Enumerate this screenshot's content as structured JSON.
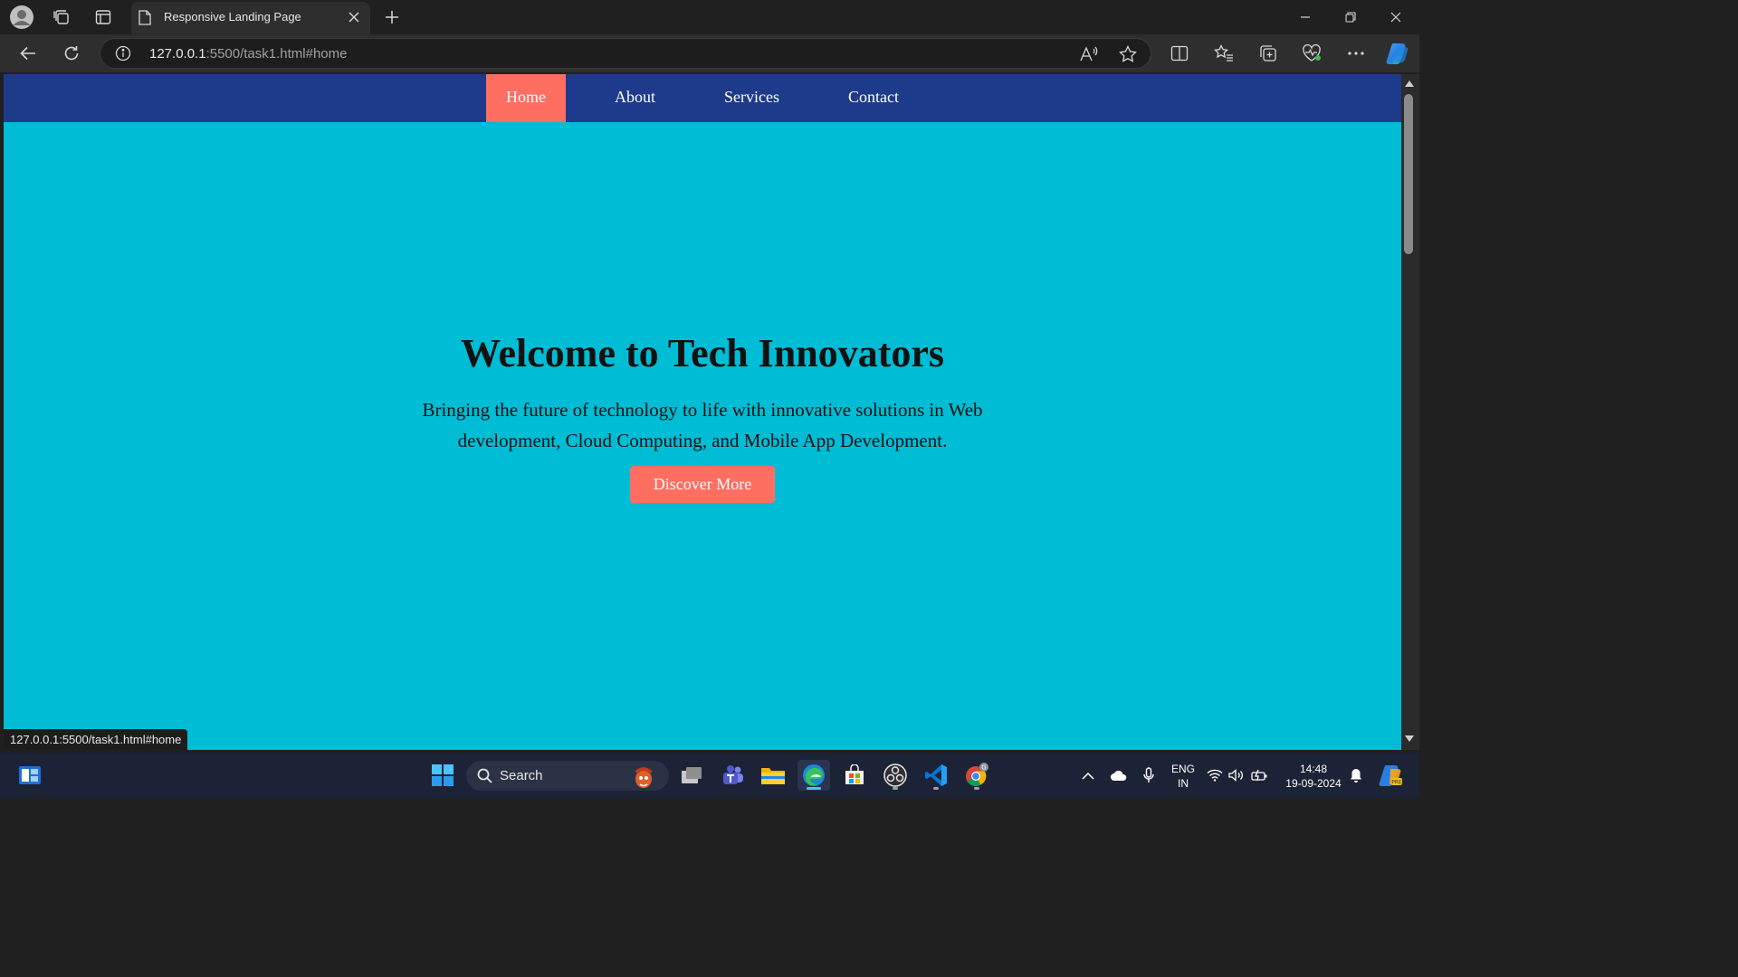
{
  "browser": {
    "tab": {
      "title": "Responsive Landing Page"
    },
    "address": {
      "host": "127.0.0.1",
      "rest": ":5500/task1.html#home"
    },
    "status_url": "127.0.0.1:5500/task1.html#home"
  },
  "page": {
    "nav": [
      {
        "label": "Home",
        "active": true
      },
      {
        "label": "About"
      },
      {
        "label": "Services"
      },
      {
        "label": "Contact"
      }
    ],
    "hero": {
      "title": "Welcome to Tech Innovators",
      "text": "Bringing the future of technology to life with innovative solutions in Web development, Cloud Computing, and Mobile App Development.",
      "button": "Discover More"
    },
    "colors": {
      "navbar": "#1e3a8a",
      "accent": "#ff6f61",
      "background": "#00bcd4"
    }
  },
  "taskbar": {
    "search_placeholder": "Search",
    "lang_1": "ENG",
    "lang_2": "IN",
    "time": "14:48",
    "date": "19-09-2024"
  }
}
